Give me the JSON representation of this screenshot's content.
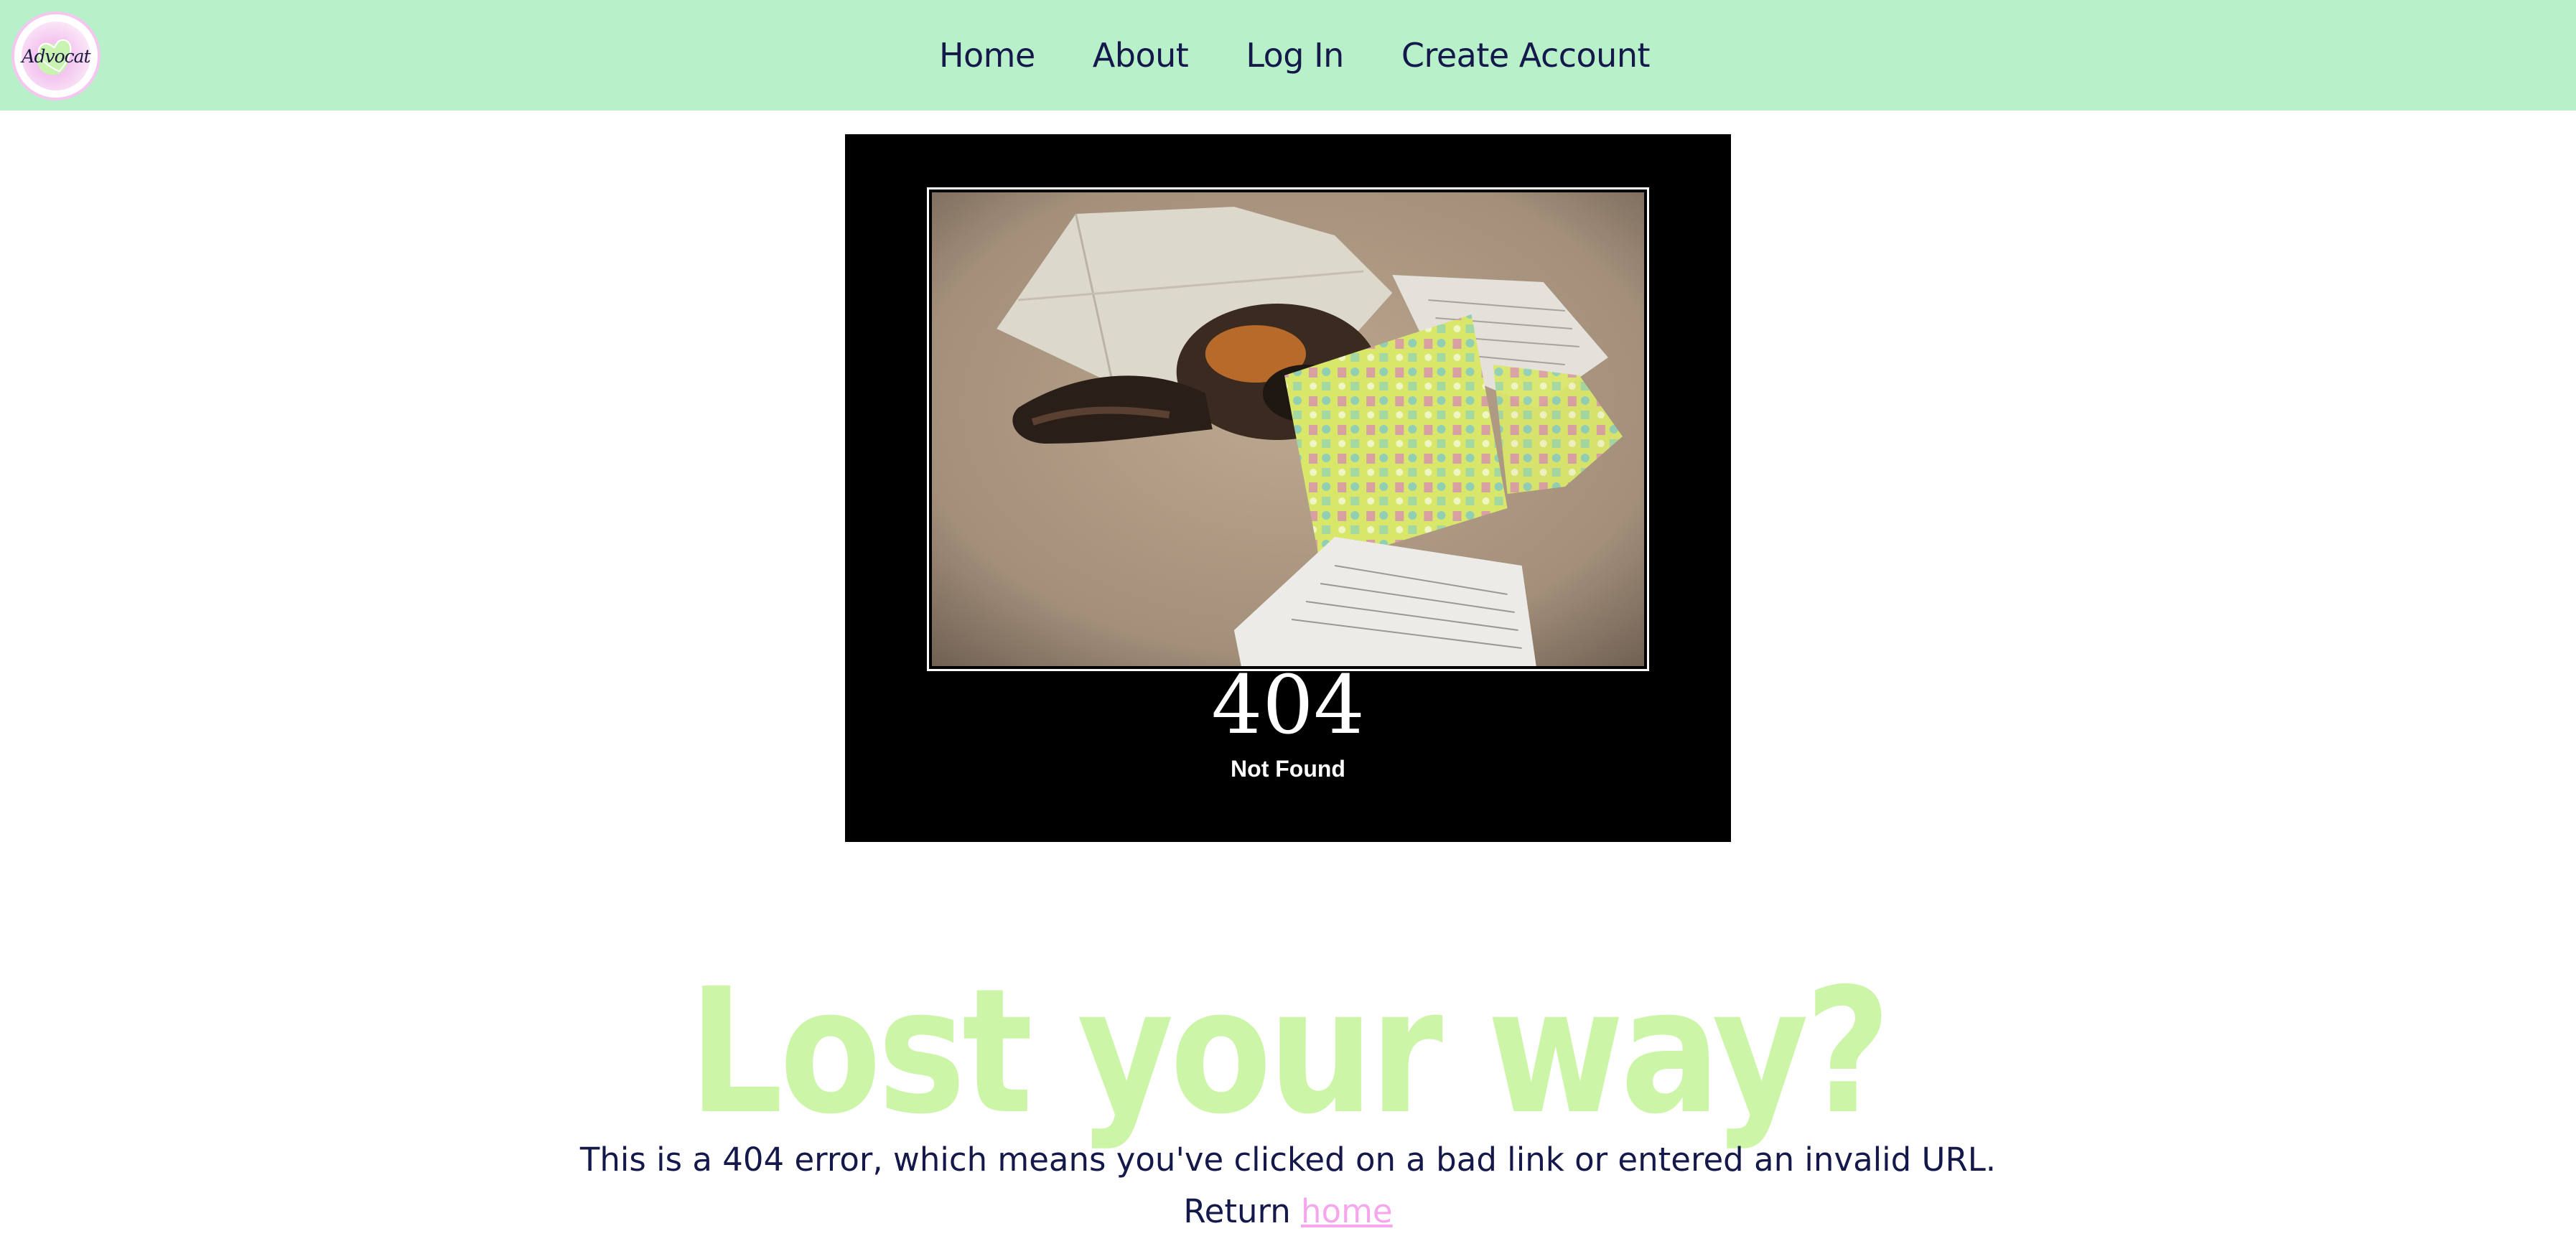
{
  "logo": {
    "text": "Advocat"
  },
  "nav": {
    "items": [
      {
        "label": "Home"
      },
      {
        "label": "About"
      },
      {
        "label": "Log In"
      },
      {
        "label": "Create Account"
      }
    ]
  },
  "poster": {
    "number": "404",
    "caption": "Not Found"
  },
  "main": {
    "headline": "Lost your way?",
    "message": "This is a 404 error, which means you've clicked on a bad link or entered an invalid URL.",
    "return_prefix": "Return",
    "return_link": "home"
  },
  "colors": {
    "navbar_bg": "#b8f0ca",
    "nav_text": "#14184a",
    "headline": "#ccf5a8",
    "link": "#f5a6ec"
  }
}
